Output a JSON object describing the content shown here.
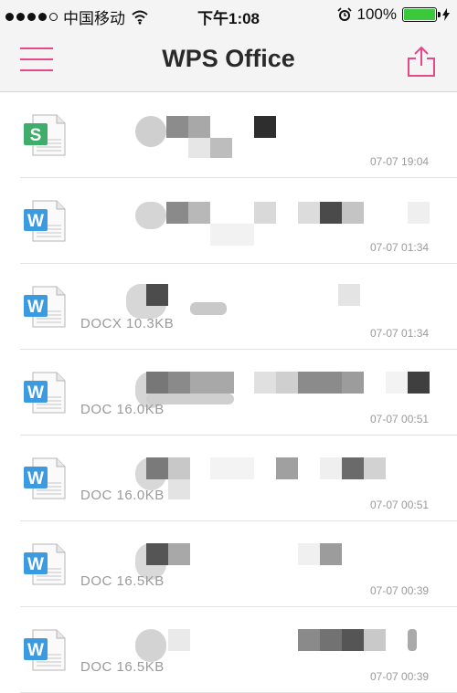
{
  "status_bar": {
    "carrier": "中国移动",
    "time": "下午1:08",
    "battery_percent": "100%",
    "battery_level": 1.0,
    "signal_bars": 4
  },
  "navbar": {
    "title": "WPS Office",
    "menu_icon": "hamburger-menu-icon",
    "share_icon": "share-upload-icon",
    "accent_color": "#e8478a"
  },
  "files": [
    {
      "type": "spreadsheet",
      "icon_letter": "S",
      "icon_color": "#3fae6a",
      "meta": "",
      "date": "07-07 19:04"
    },
    {
      "type": "word",
      "icon_letter": "W",
      "icon_color": "#3c9be0",
      "meta": "",
      "date": "07-07 01:34"
    },
    {
      "type": "word",
      "icon_letter": "W",
      "icon_color": "#3c9be0",
      "meta": "DOCX  10.3KB",
      "date": "07-07 01:34"
    },
    {
      "type": "word",
      "icon_letter": "W",
      "icon_color": "#3c9be0",
      "meta": "DOC  16.0KB",
      "date": "07-07 00:51"
    },
    {
      "type": "word",
      "icon_letter": "W",
      "icon_color": "#3c9be0",
      "meta": "DOC  16.0KB",
      "date": "07-07 00:51"
    },
    {
      "type": "word",
      "icon_letter": "W",
      "icon_color": "#3c9be0",
      "meta": "DOC  16.5KB",
      "date": "07-07 00:39"
    },
    {
      "type": "word",
      "icon_letter": "W",
      "icon_color": "#3c9be0",
      "meta": "DOC  16.5KB",
      "date": "07-07 00:39"
    }
  ]
}
